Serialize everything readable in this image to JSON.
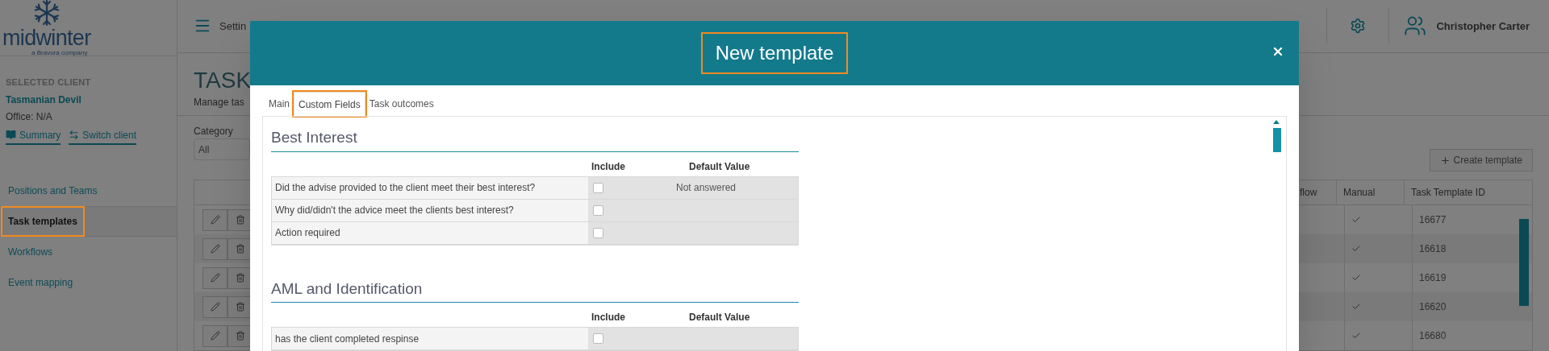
{
  "logo": {
    "name": "midwinter",
    "tagline": "a Bravura company"
  },
  "header": {
    "title": "Settin",
    "user": "Christopher Carter"
  },
  "sidebar": {
    "client_heading": "SELECTED CLIENT",
    "client_name": "Tasmanian Devil",
    "office": "Office: N/A",
    "links": [
      "Summary",
      "Switch client"
    ],
    "items": [
      {
        "label": "Positions and Teams",
        "selected": false,
        "highlighted": false
      },
      {
        "label": "Task templates",
        "selected": true,
        "highlighted": true
      },
      {
        "label": "Workflows",
        "selected": false,
        "highlighted": false
      },
      {
        "label": "Event mapping",
        "selected": false,
        "highlighted": false
      }
    ]
  },
  "page": {
    "title": "TASK",
    "subtitle": "Manage tas",
    "category_label": "Category",
    "category_value": "All",
    "create_button": "Create template"
  },
  "table": {
    "columns": [
      "flow",
      "Manual",
      "Task Template ID"
    ],
    "rows": [
      {
        "manual": true,
        "id": "16677"
      },
      {
        "manual": true,
        "id": "16618"
      },
      {
        "manual": true,
        "id": "16619"
      },
      {
        "manual": true,
        "id": "16620"
      },
      {
        "manual": true,
        "id": "16680"
      }
    ]
  },
  "modal": {
    "title": "New template",
    "title_highlighted": true,
    "tabs": [
      {
        "label": "Main",
        "selected": false,
        "highlighted": false
      },
      {
        "label": "Custom Fields",
        "selected": true,
        "highlighted": true
      },
      {
        "label": "Task outcomes",
        "selected": false,
        "highlighted": false
      }
    ],
    "sections": [
      {
        "title": "Best Interest",
        "columns": [
          "Include",
          "Default Value"
        ],
        "fields": [
          {
            "label": "Did the advise provided to the client meet their best interest?",
            "include": false,
            "default_value": "Not answered"
          },
          {
            "label": "Why did/didn't the advice meet the clients best interest?",
            "include": false
          },
          {
            "label": "Action required",
            "include": false
          }
        ]
      },
      {
        "title": "AML and Identification",
        "columns": [
          "Include",
          "Default Value"
        ],
        "fields": [
          {
            "label": "has the client completed respinse",
            "include": false
          }
        ]
      }
    ]
  }
}
